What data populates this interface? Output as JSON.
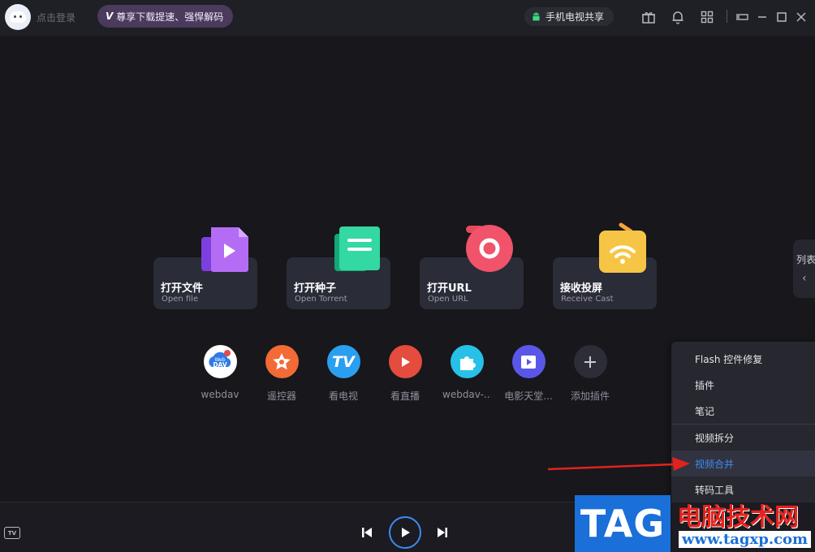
{
  "header": {
    "login_label": "点击登录",
    "vip_badge": "V",
    "vip_label": "尊享下载提速、强悍解码",
    "phone_share_label": "手机电视共享"
  },
  "icons": {
    "gift": "gift-icon",
    "bell": "bell-icon",
    "apps": "apps-icon",
    "mini": "mini-mode-icon",
    "minimize": "minimize-icon",
    "maximize": "maximize-icon",
    "close": "close-icon"
  },
  "cards": [
    {
      "name": "打开文件",
      "sub": "Open file"
    },
    {
      "name": "打开种子",
      "sub": "Open Torrent"
    },
    {
      "name": "打开URL",
      "sub": "Open URL"
    },
    {
      "name": "接收投屏",
      "sub": "Receive Cast"
    }
  ],
  "plugins": [
    {
      "label": "webdav",
      "icon_text": "Web DAV"
    },
    {
      "label": "遥控器"
    },
    {
      "label": "看电视",
      "icon_text": "TV"
    },
    {
      "label": "看直播"
    },
    {
      "label": "webdav-..."
    },
    {
      "label": "电影天堂..."
    },
    {
      "label": "添加插件"
    }
  ],
  "side_tab": {
    "label": "列表"
  },
  "menu": {
    "items": [
      "Flash 控件修复",
      "插件",
      "笔记",
      "视频拆分",
      "视频合并",
      "转码工具"
    ],
    "active_index": 4
  },
  "bottom": {
    "tv_label": "TV"
  },
  "watermark": {
    "tag": "TAG",
    "cn": "电脑技术网",
    "url": "www.tagxp.com"
  },
  "colors": {
    "accent": "#3d8cf0",
    "arrow": "#e0231c",
    "background": "#17171c"
  }
}
